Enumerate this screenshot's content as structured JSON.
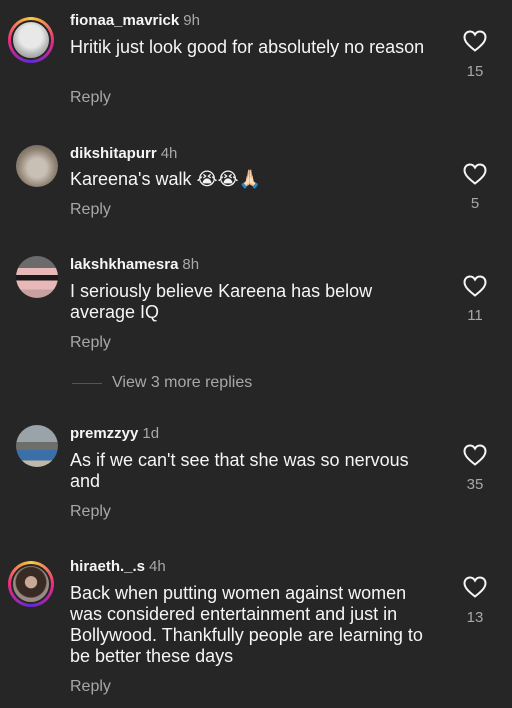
{
  "comments": [
    {
      "username": "fionaa_mavrick",
      "time": "9h",
      "text": "Hritik just look good for absolutely no reason",
      "reply": "Reply",
      "likes": "15",
      "has_story_ring": true
    },
    {
      "username": "dikshitapurr",
      "time": "4h",
      "text": "Kareena's walk 😭😭🙏🏻",
      "reply": "Reply",
      "likes": "5",
      "has_story_ring": false
    },
    {
      "username": "lakshkhamesra",
      "time": "8h",
      "text": "I seriously believe Kareena has below average IQ",
      "reply": "Reply",
      "likes": "11",
      "has_story_ring": false
    },
    {
      "username": "premzzyy",
      "time": "1d",
      "text": "As if we can't see that she was so nervous and",
      "reply": "Reply",
      "likes": "35",
      "has_story_ring": false
    },
    {
      "username": "hiraeth._.s",
      "time": "4h",
      "text": "Back when putting women against women was considered entertainment and just in Bollywood. Thankfully people are learning to be better these days",
      "reply": "Reply",
      "likes": "13",
      "has_story_ring": true
    }
  ],
  "view_more_replies": "View 3 more replies",
  "icons": {
    "like": "heart-outline-icon"
  },
  "colors": {
    "background": "#262626",
    "text": "#f5f5f5",
    "muted": "#a8a8a8"
  }
}
